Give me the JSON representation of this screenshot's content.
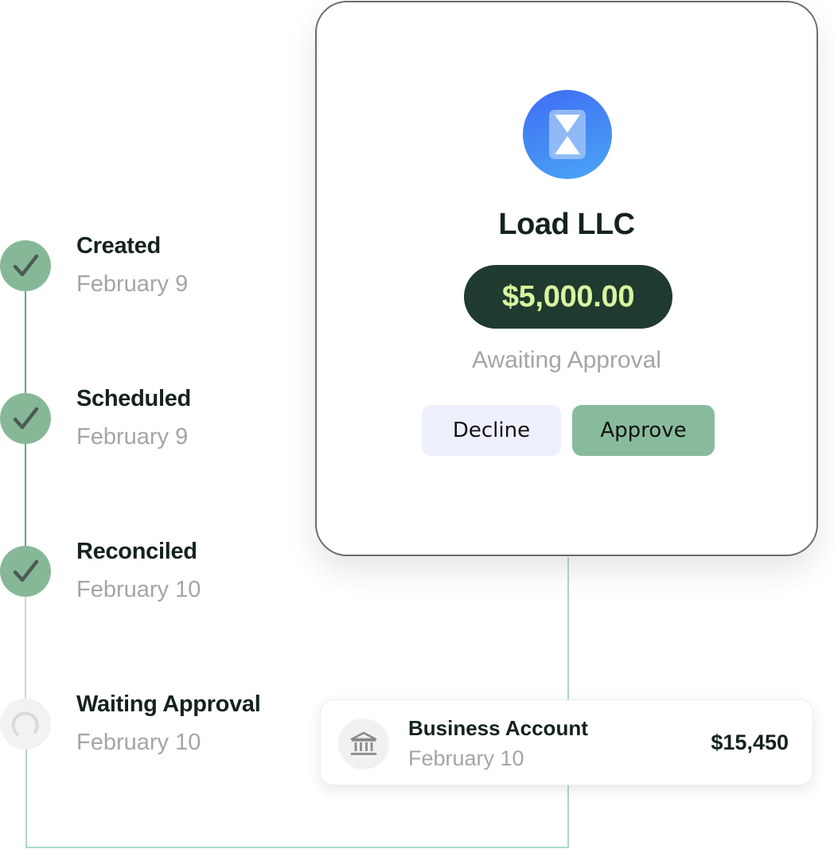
{
  "timeline": {
    "steps": [
      {
        "title": "Created",
        "date": "February 9",
        "status": "done"
      },
      {
        "title": "Scheduled",
        "date": "February 9",
        "status": "done"
      },
      {
        "title": "Reconciled",
        "date": "February 10",
        "status": "done"
      },
      {
        "title": "Waiting Approval",
        "date": "February 10",
        "status": "pending"
      }
    ]
  },
  "card": {
    "icon": "hourglass-icon",
    "company": "Load LLC",
    "amount": "$5,000.00",
    "status": "Awaiting Approval",
    "decline_label": "Decline",
    "approve_label": "Approve"
  },
  "account": {
    "icon": "bank-icon",
    "title": "Business Account",
    "date": "February 10",
    "amount": "$15,450"
  },
  "colors": {
    "done_circle": "#86b898",
    "amount_pill": "#1f3a2e",
    "amount_text": "#d8f5a0",
    "approve_button": "#88bb9c",
    "decline_button": "#eeeffd",
    "avatar_gradient": [
      "#3f6cf4",
      "#4aa6f5"
    ]
  }
}
